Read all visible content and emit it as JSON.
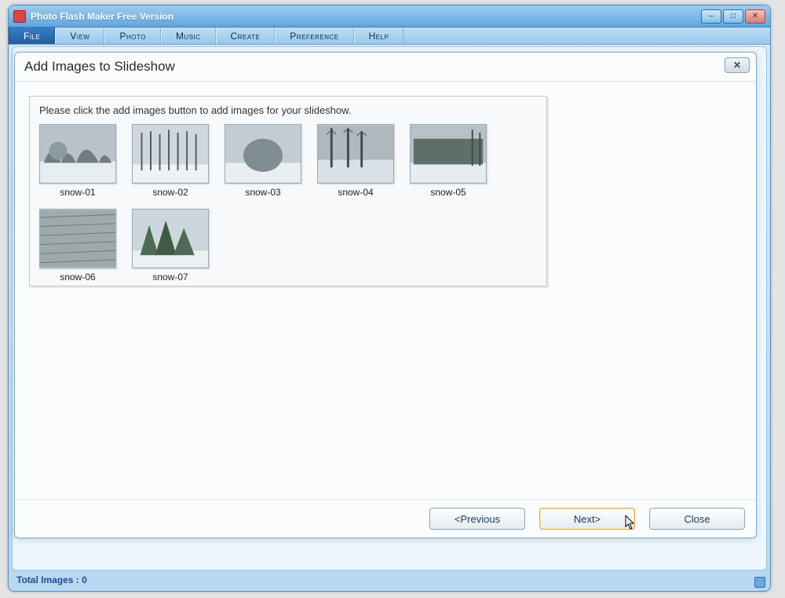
{
  "window": {
    "title": "Photo Flash Maker Free Version"
  },
  "menu": {
    "items": [
      {
        "label": "File",
        "active": true
      },
      {
        "label": "View",
        "active": false
      },
      {
        "label": "Photo",
        "active": false
      },
      {
        "label": "Music",
        "active": false
      },
      {
        "label": "Create",
        "active": false
      },
      {
        "label": "Preference",
        "active": false
      },
      {
        "label": "Help",
        "active": false
      }
    ]
  },
  "status": {
    "total_images_label": "Total Images : 0"
  },
  "dialog": {
    "title": "Add Images to Slideshow",
    "prompt": "Please click the add images button to add  images for your slideshow.",
    "thumbnails": [
      {
        "label": "snow-01"
      },
      {
        "label": "snow-02"
      },
      {
        "label": "snow-03"
      },
      {
        "label": "snow-04"
      },
      {
        "label": "snow-05"
      },
      {
        "label": "snow-06"
      },
      {
        "label": "snow-07"
      }
    ],
    "buttons": {
      "previous": "<Previous",
      "next": "Next>",
      "close": "Close"
    }
  }
}
